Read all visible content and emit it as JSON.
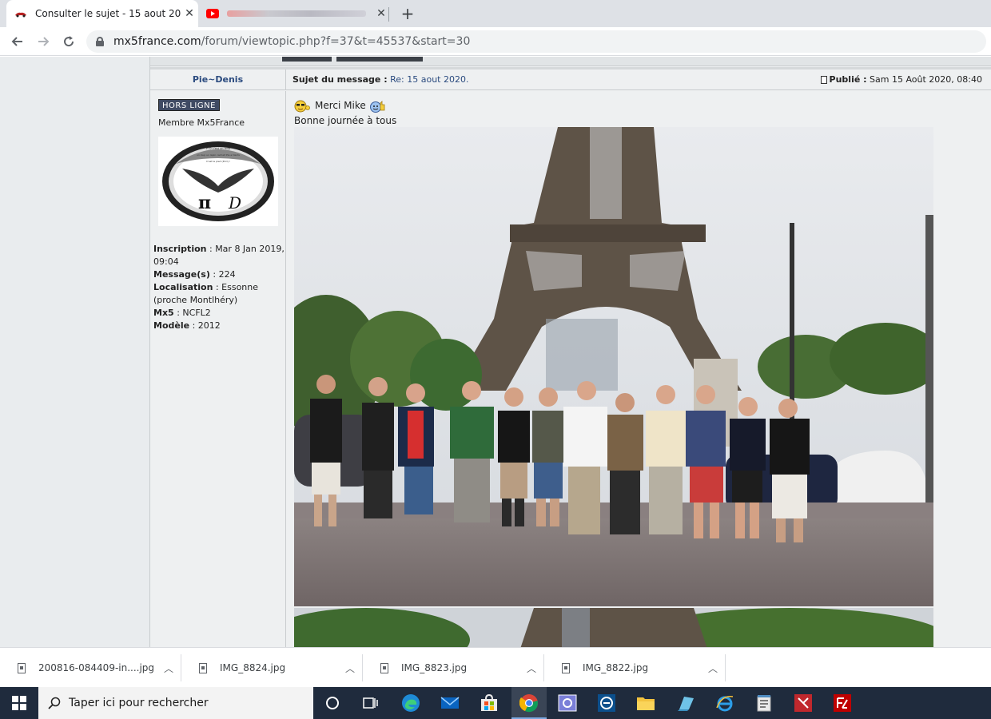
{
  "browser": {
    "tabs": [
      {
        "title": "Consulter le sujet - 15 aout 2020",
        "active": true
      },
      {
        "title": "",
        "active": false,
        "blurred": true
      }
    ],
    "new_tab": "+",
    "close_glyph": "✕",
    "url_host": "mx5france.com",
    "url_path": "/forum/viewtopic.php?f=37&t=45537&start=30"
  },
  "post": {
    "author": "Pie~Denis",
    "subject_label": "Sujet du message :",
    "subject_value": "Re: 15 aout 2020.",
    "published_label": "Publié :",
    "published_value": "Sam 15 Août 2020, 08:40",
    "status_badge": "HORS LIGNE",
    "rank": "Membre Mx5France",
    "avatar_text_lines": [
      "Pi D c'est un loup",
      "un loup un lapin cachait Pie a Dents",
      "C'est le pied (Pi-D) !"
    ],
    "avatar_letters": [
      "π",
      "D"
    ],
    "profile": [
      {
        "label": "Inscription",
        "value": "Mar 8 Jan 2019, 09:04"
      },
      {
        "label": "Message(s)",
        "value": "224"
      },
      {
        "label": "Localisation",
        "value": "Essonne (proche Montlhéry)"
      },
      {
        "label": "Mx5",
        "value": "NCFL2"
      },
      {
        "label": "Modèle",
        "value": "2012"
      }
    ],
    "body_line1": "Merci Mike",
    "body_line2": "Bonne journée à tous"
  },
  "downloads": [
    {
      "name": "200816-084409-in....jpg"
    },
    {
      "name": "IMG_8824.jpg"
    },
    {
      "name": "IMG_8823.jpg"
    },
    {
      "name": "IMG_8822.jpg"
    }
  ],
  "taskbar": {
    "search_placeholder": "Taper ici pour rechercher"
  },
  "colors": {
    "link": "#2b4b7f",
    "badge": "#3f4a63",
    "taskbar": "#1f2b3d"
  }
}
